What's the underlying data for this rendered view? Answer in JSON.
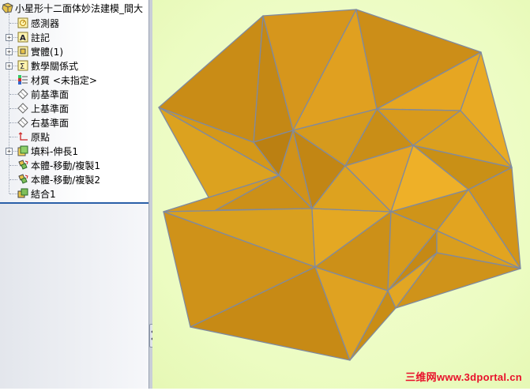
{
  "tree": {
    "root_label": "小星形十二面体妙法建模_間大",
    "items": [
      {
        "label": "感測器",
        "icon": "sensor-icon",
        "expandable": false
      },
      {
        "label": "註記",
        "icon": "annotation-icon",
        "expandable": true
      },
      {
        "label": "實體(1)",
        "icon": "solid-bodies-icon",
        "expandable": true
      },
      {
        "label": "數學關係式",
        "icon": "equations-icon",
        "expandable": true
      },
      {
        "label": "材質 <未指定>",
        "icon": "material-icon",
        "expandable": false
      },
      {
        "label": "前基準面",
        "icon": "plane-icon",
        "expandable": false
      },
      {
        "label": "上基準面",
        "icon": "plane-icon",
        "expandable": false
      },
      {
        "label": "右基準面",
        "icon": "plane-icon",
        "expandable": false
      },
      {
        "label": "原點",
        "icon": "origin-icon",
        "expandable": false
      },
      {
        "label": "填料-伸長1",
        "icon": "extrude-icon",
        "expandable": true
      },
      {
        "label": "本體-移動/複製1",
        "icon": "move-copy-icon",
        "expandable": false
      },
      {
        "label": "本體-移動/複製2",
        "icon": "move-copy-icon",
        "expandable": false
      },
      {
        "label": "結合1",
        "icon": "combine-icon",
        "expandable": false
      }
    ]
  },
  "watermark": "三维网www.3dportal.cn",
  "colors": {
    "viewport_bg": "#ecfcc2",
    "model_face": "#d9961a",
    "model_edge": "#7f8aa0",
    "watermark": "#e8102a"
  }
}
